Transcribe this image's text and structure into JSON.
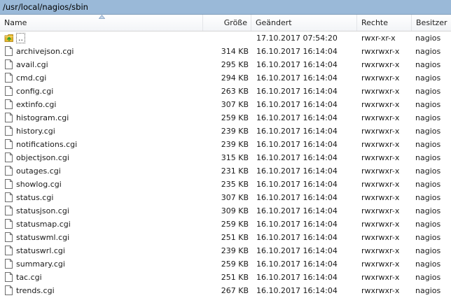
{
  "path": "/usr/local/nagios/sbin",
  "columns": {
    "name": "Name",
    "size": "Größe",
    "modified": "Geändert",
    "permissions": "Rechte",
    "owner": "Besitzer"
  },
  "icons": {
    "parent": "folder-up-icon",
    "file": "file-icon"
  },
  "colors": {
    "path_bar": "#9ab9d8",
    "folder_up": "#e8b92e",
    "arrow_green": "#2e9e2e"
  },
  "parent_row": {
    "name": "..",
    "size": "",
    "modified": "17.10.2017 07:54:20",
    "permissions": "rwxr-xr-x",
    "owner": "nagios"
  },
  "files": [
    {
      "name": "archivejson.cgi",
      "size": "314 KB",
      "modified": "16.10.2017 16:14:04",
      "permissions": "rwxrwxr-x",
      "owner": "nagios"
    },
    {
      "name": "avail.cgi",
      "size": "295 KB",
      "modified": "16.10.2017 16:14:04",
      "permissions": "rwxrwxr-x",
      "owner": "nagios"
    },
    {
      "name": "cmd.cgi",
      "size": "294 KB",
      "modified": "16.10.2017 16:14:04",
      "permissions": "rwxrwxr-x",
      "owner": "nagios"
    },
    {
      "name": "config.cgi",
      "size": "263 KB",
      "modified": "16.10.2017 16:14:04",
      "permissions": "rwxrwxr-x",
      "owner": "nagios"
    },
    {
      "name": "extinfo.cgi",
      "size": "307 KB",
      "modified": "16.10.2017 16:14:04",
      "permissions": "rwxrwxr-x",
      "owner": "nagios"
    },
    {
      "name": "histogram.cgi",
      "size": "259 KB",
      "modified": "16.10.2017 16:14:04",
      "permissions": "rwxrwxr-x",
      "owner": "nagios"
    },
    {
      "name": "history.cgi",
      "size": "239 KB",
      "modified": "16.10.2017 16:14:04",
      "permissions": "rwxrwxr-x",
      "owner": "nagios"
    },
    {
      "name": "notifications.cgi",
      "size": "239 KB",
      "modified": "16.10.2017 16:14:04",
      "permissions": "rwxrwxr-x",
      "owner": "nagios"
    },
    {
      "name": "objectjson.cgi",
      "size": "315 KB",
      "modified": "16.10.2017 16:14:04",
      "permissions": "rwxrwxr-x",
      "owner": "nagios"
    },
    {
      "name": "outages.cgi",
      "size": "231 KB",
      "modified": "16.10.2017 16:14:04",
      "permissions": "rwxrwxr-x",
      "owner": "nagios"
    },
    {
      "name": "showlog.cgi",
      "size": "235 KB",
      "modified": "16.10.2017 16:14:04",
      "permissions": "rwxrwxr-x",
      "owner": "nagios"
    },
    {
      "name": "status.cgi",
      "size": "307 KB",
      "modified": "16.10.2017 16:14:04",
      "permissions": "rwxrwxr-x",
      "owner": "nagios"
    },
    {
      "name": "statusjson.cgi",
      "size": "309 KB",
      "modified": "16.10.2017 16:14:04",
      "permissions": "rwxrwxr-x",
      "owner": "nagios"
    },
    {
      "name": "statusmap.cgi",
      "size": "259 KB",
      "modified": "16.10.2017 16:14:04",
      "permissions": "rwxrwxr-x",
      "owner": "nagios"
    },
    {
      "name": "statuswml.cgi",
      "size": "251 KB",
      "modified": "16.10.2017 16:14:04",
      "permissions": "rwxrwxr-x",
      "owner": "nagios"
    },
    {
      "name": "statuswrl.cgi",
      "size": "239 KB",
      "modified": "16.10.2017 16:14:04",
      "permissions": "rwxrwxr-x",
      "owner": "nagios"
    },
    {
      "name": "summary.cgi",
      "size": "259 KB",
      "modified": "16.10.2017 16:14:04",
      "permissions": "rwxrwxr-x",
      "owner": "nagios"
    },
    {
      "name": "tac.cgi",
      "size": "251 KB",
      "modified": "16.10.2017 16:14:04",
      "permissions": "rwxrwxr-x",
      "owner": "nagios"
    },
    {
      "name": "trends.cgi",
      "size": "267 KB",
      "modified": "16.10.2017 16:14:04",
      "permissions": "rwxrwxr-x",
      "owner": "nagios"
    }
  ]
}
